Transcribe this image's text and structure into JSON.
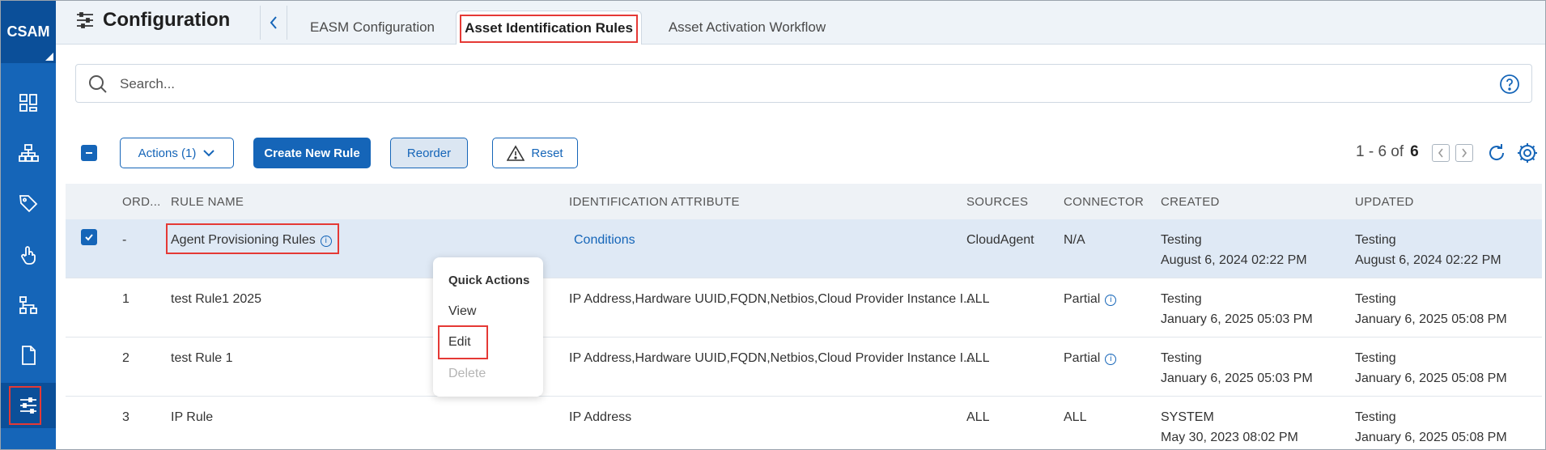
{
  "sidebar": {
    "brand": "CSAM",
    "items": [
      {
        "icon": "dashboard-icon"
      },
      {
        "icon": "asset-inventory-icon"
      },
      {
        "icon": "tag-icon"
      },
      {
        "icon": "touch-icon"
      },
      {
        "icon": "hierarchy-icon"
      },
      {
        "icon": "document-icon"
      },
      {
        "icon": "configuration-icon",
        "active": true
      }
    ]
  },
  "header": {
    "title": "Configuration",
    "tabs": [
      {
        "label": "EASM Configuration"
      },
      {
        "label": "Asset Identification Rules",
        "active": true
      },
      {
        "label": "Asset Activation Workflow"
      }
    ]
  },
  "search": {
    "placeholder": "Search..."
  },
  "toolbar": {
    "actions_label": "Actions (1)",
    "create_label": "Create New Rule",
    "reorder_label": "Reorder",
    "reset_label": "Reset"
  },
  "pagination": {
    "range": "1 - 6 of",
    "total": "6"
  },
  "table": {
    "columns": [
      "ORD...",
      "RULE NAME",
      "IDENTIFICATION ATTRIBUTE",
      "SOURCES",
      "CONNECTOR",
      "CREATED",
      "UPDATED"
    ],
    "rows": [
      {
        "order": "-",
        "name": "Agent Provisioning Rules",
        "attribute": "Conditions",
        "sources": "CloudAgent",
        "connector": "N/A",
        "created_by": "Testing",
        "created_at": "August 6, 2024 02:22 PM",
        "updated_by": "Testing",
        "updated_at": "August 6, 2024 02:22 PM"
      },
      {
        "order": "1",
        "name": "test Rule1 2025",
        "attribute": "IP Address,Hardware UUID,FQDN,Netbios,Cloud Provider Instance I...",
        "sources": "ALL",
        "connector": "Partial",
        "created_by": "Testing",
        "created_at": "January 6, 2025 05:03 PM",
        "updated_by": "Testing",
        "updated_at": "January 6, 2025 05:08 PM"
      },
      {
        "order": "2",
        "name": "test Rule 1",
        "attribute": "IP Address,Hardware UUID,FQDN,Netbios,Cloud Provider Instance I...",
        "sources": "ALL",
        "connector": "Partial",
        "created_by": "Testing",
        "created_at": "January 6, 2025 05:03 PM",
        "updated_by": "Testing",
        "updated_at": "January 6, 2025 05:08 PM"
      },
      {
        "order": "3",
        "name": "IP Rule",
        "attribute": "IP Address",
        "sources": "ALL",
        "connector": "ALL",
        "created_by": "SYSTEM",
        "created_at": "May 30, 2023 08:02 PM",
        "updated_by": "Testing",
        "updated_at": "January 6, 2025 05:08 PM"
      }
    ]
  },
  "quick_actions": {
    "title": "Quick Actions",
    "items": [
      {
        "label": "View",
        "enabled": true
      },
      {
        "label": "Edit",
        "enabled": true
      },
      {
        "label": "Delete",
        "enabled": false
      }
    ]
  },
  "colors": {
    "primary": "#1565b8",
    "sidebar": "#1565b8",
    "sidebar_dark": "#0b4f99",
    "highlight": "#e53935",
    "selected_row": "#dfe9f5"
  }
}
